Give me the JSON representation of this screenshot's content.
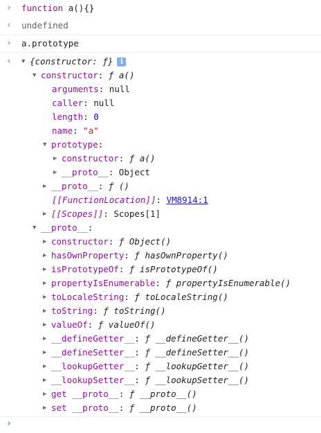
{
  "lines": {
    "l1": {
      "kw": "function",
      "rest": " a(){}"
    },
    "l2": {
      "text": "undefined"
    },
    "l3": {
      "text": "a.prototype"
    },
    "l4": {
      "obj": "{constructor: ƒ}",
      "badge": "i"
    },
    "l5": {
      "key": "constructor",
      "colon": ": ",
      "val": "ƒ a()"
    },
    "l6": {
      "key": "arguments",
      "colon": ": ",
      "val": "null"
    },
    "l7": {
      "key": "caller",
      "colon": ": ",
      "val": "null"
    },
    "l8": {
      "key": "length",
      "colon": ": ",
      "val": "0"
    },
    "l9": {
      "key": "name",
      "colon": ": ",
      "val": "\"a\""
    },
    "l10": {
      "key": "prototype",
      "colon": ":"
    },
    "l11": {
      "key": "constructor",
      "colon": ": ",
      "val": "ƒ a()"
    },
    "l12": {
      "key": "__proto__",
      "colon": ": ",
      "val": "Object"
    },
    "l13": {
      "key": "__proto__",
      "colon": ": ",
      "val": "ƒ ()"
    },
    "l14": {
      "key": "[[FunctionLocation]]",
      "colon": ": ",
      "val": "VM8914:1"
    },
    "l15": {
      "key": "[[Scopes]]",
      "colon": ": ",
      "val": "Scopes[1]"
    },
    "l16": {
      "key": "__proto__",
      "colon": ":"
    },
    "p1": {
      "key": "constructor",
      "colon": ": ",
      "val": "ƒ Object()"
    },
    "p2": {
      "key": "hasOwnProperty",
      "colon": ": ",
      "val": "ƒ hasOwnProperty()"
    },
    "p3": {
      "key": "isPrototypeOf",
      "colon": ": ",
      "val": "ƒ isPrototypeOf()"
    },
    "p4": {
      "key": "propertyIsEnumerable",
      "colon": ": ",
      "val": "ƒ propertyIsEnumerable()"
    },
    "p5": {
      "key": "toLocaleString",
      "colon": ": ",
      "val": "ƒ toLocaleString()"
    },
    "p6": {
      "key": "toString",
      "colon": ": ",
      "val": "ƒ toString()"
    },
    "p7": {
      "key": "valueOf",
      "colon": ": ",
      "val": "ƒ valueOf()"
    },
    "p8": {
      "key": "__defineGetter__",
      "colon": ": ",
      "val": "ƒ __defineGetter__()"
    },
    "p9": {
      "key": "__defineSetter__",
      "colon": ": ",
      "val": "ƒ __defineSetter__()"
    },
    "p10": {
      "key": "__lookupGetter__",
      "colon": ": ",
      "val": "ƒ __lookupGetter__()"
    },
    "p11": {
      "key": "__lookupSetter__",
      "colon": ": ",
      "val": "ƒ __lookupSetter__()"
    },
    "p12": {
      "key": "get __proto__",
      "colon": ": ",
      "val": "ƒ __proto__()"
    },
    "p13": {
      "key": "set __proto__",
      "colon": ": ",
      "val": "ƒ __proto__()"
    }
  },
  "gutter": {
    "input": "›",
    "output": "‹",
    "expanded": "▼",
    "collapsed": "▶"
  },
  "colors": {
    "key": "#881391",
    "number": "#1c00cf",
    "string": "#c41a16",
    "link": "#1a1aa6",
    "badge": "#7eb3f0"
  },
  "icons": {
    "input_prompt": "chevron-right-icon",
    "output_return": "chevron-left-icon",
    "expand": "triangle-down-icon",
    "collapse": "triangle-right-icon",
    "info": "info-icon"
  }
}
